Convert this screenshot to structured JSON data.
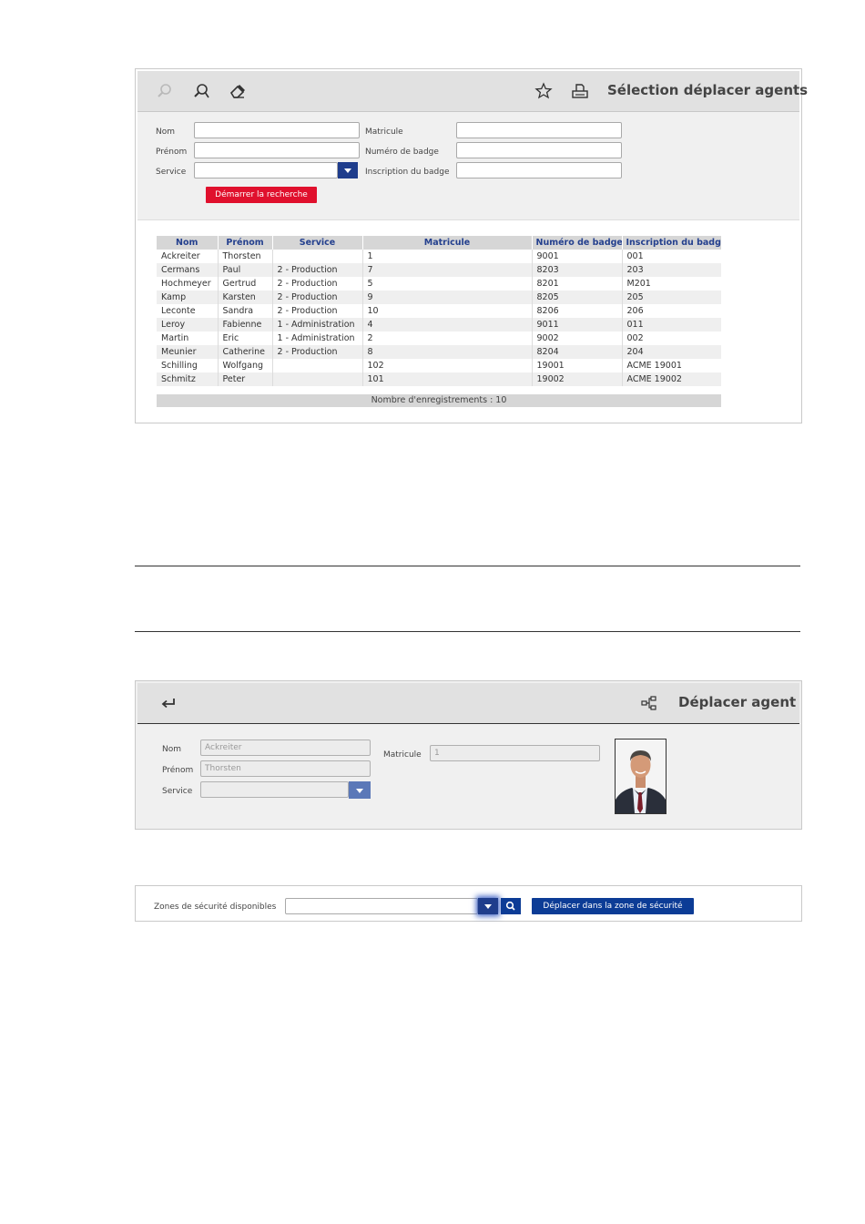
{
  "selection_panel": {
    "title": "Sélection déplacer agents",
    "icons": [
      "search-icon",
      "search-settings-icon",
      "eraser-icon",
      "star-icon",
      "print-icon"
    ],
    "form": {
      "nom_label": "Nom",
      "nom_value": "",
      "prenom_label": "Prénom",
      "prenom_value": "",
      "service_label": "Service",
      "service_value": "",
      "matricule_label": "Matricule",
      "matricule_value": "",
      "badge_number_label": "Numéro de badge",
      "badge_number_value": "",
      "badge_inscription_label": "Inscription du badge",
      "badge_inscription_value": "",
      "search_button": "Démarrer la recherche"
    },
    "table": {
      "headers": [
        "Nom",
        "Prénom",
        "Service",
        "Matricule",
        "Numéro de badge",
        "Inscription du badge"
      ],
      "rows": [
        [
          "Ackreiter",
          "Thorsten",
          "",
          "1",
          "9001",
          "001"
        ],
        [
          "Cermans",
          "Paul",
          "2 - Production",
          "7",
          "8203",
          "203"
        ],
        [
          "Hochmeyer",
          "Gertrud",
          "2 - Production",
          "5",
          "8201",
          "M201"
        ],
        [
          "Kamp",
          "Karsten",
          "2 - Production",
          "9",
          "8205",
          "205"
        ],
        [
          "Leconte",
          "Sandra",
          "2 - Production",
          "10",
          "8206",
          "206"
        ],
        [
          "Leroy",
          "Fabienne",
          "1 - Administration",
          "4",
          "9011",
          "011"
        ],
        [
          "Martin",
          "Eric",
          "1 - Administration",
          "2",
          "9002",
          "002"
        ],
        [
          "Meunier",
          "Catherine",
          "2 - Production",
          "8",
          "8204",
          "204"
        ],
        [
          "Schilling",
          "Wolfgang",
          "",
          "102",
          "19001",
          "ACME 19001"
        ],
        [
          "Schmitz",
          "Peter",
          "",
          "101",
          "19002",
          "ACME 19002"
        ]
      ],
      "footer": "Nombre d'enregistrements : 10"
    }
  },
  "move_panel": {
    "title": "Déplacer agent",
    "icons": [
      "return-icon",
      "hierarchy-icon"
    ],
    "nom_label": "Nom",
    "nom_value": "Ackreiter",
    "prenom_label": "Prénom",
    "prenom_value": "Thorsten",
    "service_label": "Service",
    "service_value": "",
    "matricule_label": "Matricule",
    "matricule_value": "1"
  },
  "zones_panel": {
    "label": "Zones de sécurité disponibles",
    "value": "",
    "move_button": "Déplacer dans la zone de sécurité",
    "icons": [
      "chevron-down-icon",
      "search-icon"
    ]
  },
  "colors": {
    "accent_red": "#e0102d",
    "accent_blue": "#0c3c96",
    "header_text_blue": "#24408e",
    "toolbar_gray": "#e1e1e1"
  }
}
